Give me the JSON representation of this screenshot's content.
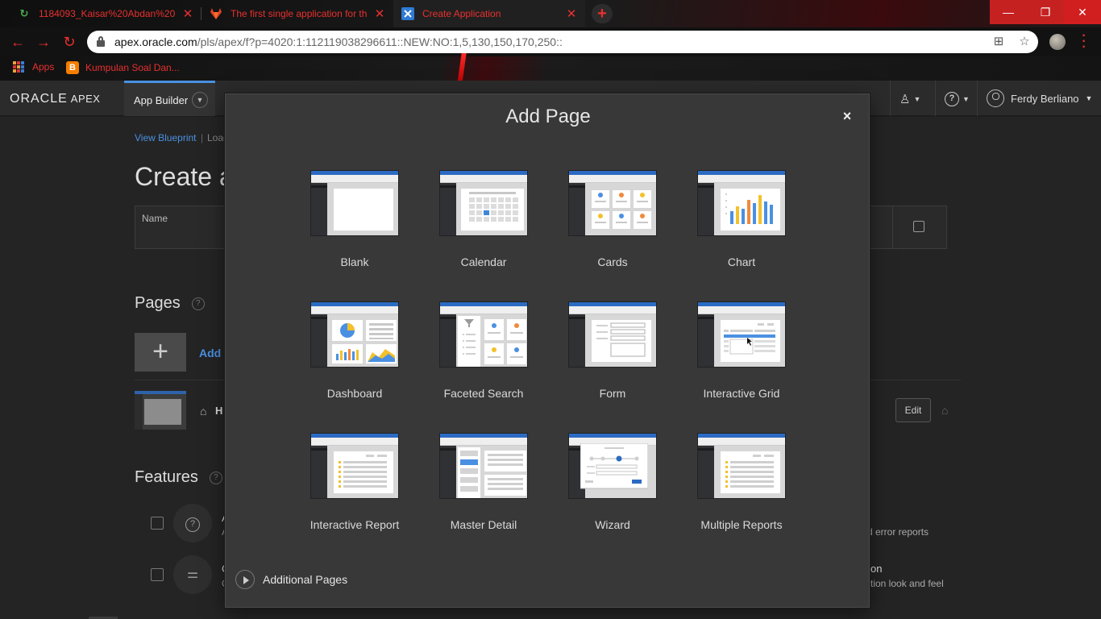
{
  "browser": {
    "tabs": [
      {
        "title": "1184093_Kaisar%20Abdan%20S...",
        "favicon": "refresh-icon"
      },
      {
        "title": "The first single application for the...",
        "favicon": "gitlab-icon"
      },
      {
        "title": "Create Application",
        "favicon": "apex-icon"
      }
    ],
    "url_host": "apex.oracle.com",
    "url_path": "/pls/apex/f?p=4020:1:112119038296611::NEW:NO:1,5,130,150,170,250::",
    "bookmarks": [
      {
        "label": "Apps"
      },
      {
        "label": "Kumpulan Soal Dan..."
      }
    ],
    "accent_color": "#e8302f"
  },
  "apex": {
    "logo_oracle": "ORACLE",
    "logo_apex": "APEX",
    "menu_label": "App Builder",
    "user_name": "Ferdy Berliano"
  },
  "background": {
    "view_blueprint": "View Blueprint",
    "load": "Load",
    "sep": "|",
    "create_title": "Create a",
    "name_label": "Name",
    "pages_heading": "Pages",
    "add_text": "Add",
    "home_label": "H",
    "edit_label": "Edit",
    "features_heading": "Features",
    "feat1_a": "A",
    "feat1_b": "A",
    "feat2_a": "C",
    "feat2_b": "C",
    "feat_right_1": "d error reports",
    "feat_right_2": "on",
    "feat_right_3": "tion look and feel"
  },
  "modal": {
    "title": "Add Page",
    "close_label": "×",
    "tiles": [
      {
        "label": "Blank"
      },
      {
        "label": "Calendar"
      },
      {
        "label": "Cards"
      },
      {
        "label": "Chart"
      },
      {
        "label": "Dashboard"
      },
      {
        "label": "Faceted Search"
      },
      {
        "label": "Form"
      },
      {
        "label": "Interactive Grid"
      },
      {
        "label": "Interactive Report"
      },
      {
        "label": "Master Detail"
      },
      {
        "label": "Wizard"
      },
      {
        "label": "Multiple Reports"
      }
    ],
    "additional_pages": "Additional Pages"
  }
}
